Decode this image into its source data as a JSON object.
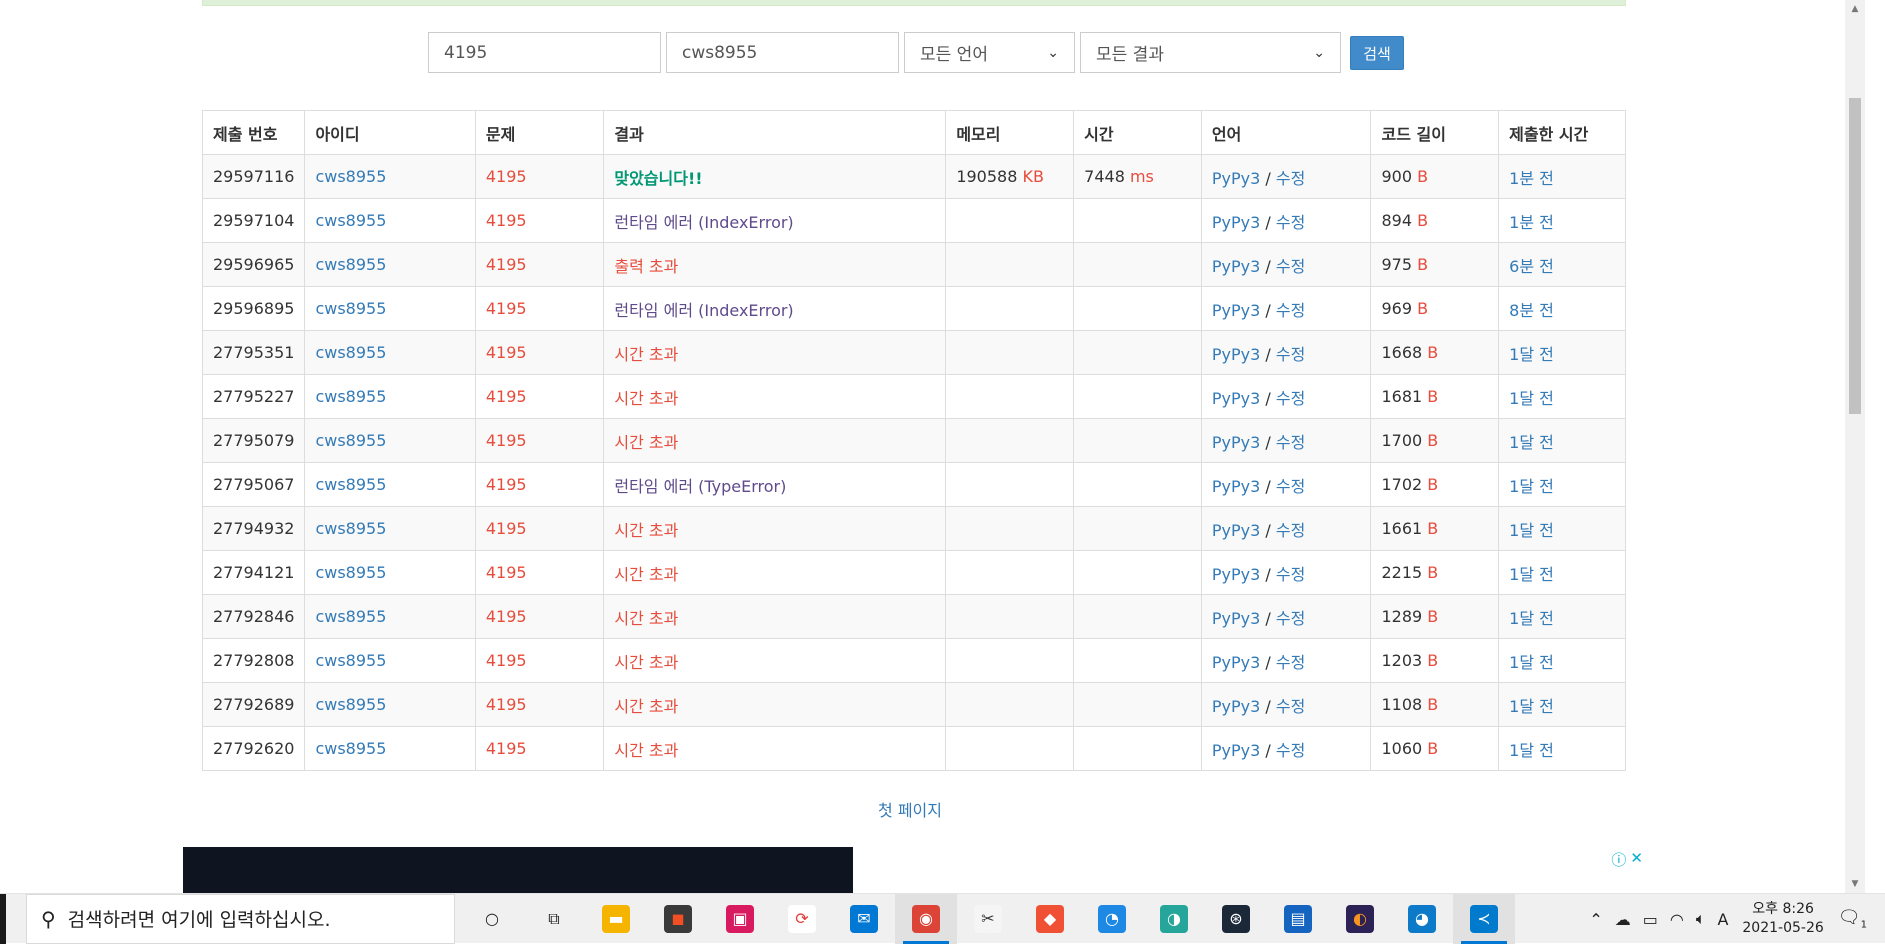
{
  "search": {
    "problem_value": "4195",
    "user_value": "cws8955",
    "language_selected": "모든 언어",
    "result_selected": "모든 결과",
    "button_label": "검색"
  },
  "table": {
    "headers": [
      "제출 번호",
      "아이디",
      "문제",
      "결과",
      "메모리",
      "시간",
      "언어",
      "코드 길이",
      "제출한 시간"
    ],
    "memory_unit": "KB",
    "time_unit": "ms",
    "length_unit": "B",
    "lang_sep": "/",
    "rows": [
      {
        "id": "29597116",
        "user": "cws8955",
        "problem": "4195",
        "result": "맞았습니다!!",
        "result_class": "ac",
        "result_detail": "",
        "memory": "190588",
        "time": "7448",
        "lang": "PyPy3",
        "edit": "수정",
        "length": "900",
        "ago": "1분 전"
      },
      {
        "id": "29597104",
        "user": "cws8955",
        "problem": "4195",
        "result": "런타임 에러",
        "result_class": "rte",
        "result_detail": "(IndexError)",
        "memory": "",
        "time": "",
        "lang": "PyPy3",
        "edit": "수정",
        "length": "894",
        "ago": "1분 전"
      },
      {
        "id": "29596965",
        "user": "cws8955",
        "problem": "4195",
        "result": "출력 초과",
        "result_class": "ole",
        "result_detail": "",
        "memory": "",
        "time": "",
        "lang": "PyPy3",
        "edit": "수정",
        "length": "975",
        "ago": "6분 전"
      },
      {
        "id": "29596895",
        "user": "cws8955",
        "problem": "4195",
        "result": "런타임 에러",
        "result_class": "rte",
        "result_detail": "(IndexError)",
        "memory": "",
        "time": "",
        "lang": "PyPy3",
        "edit": "수정",
        "length": "969",
        "ago": "8분 전"
      },
      {
        "id": "27795351",
        "user": "cws8955",
        "problem": "4195",
        "result": "시간 초과",
        "result_class": "tle",
        "result_detail": "",
        "memory": "",
        "time": "",
        "lang": "PyPy3",
        "edit": "수정",
        "length": "1668",
        "ago": "1달 전"
      },
      {
        "id": "27795227",
        "user": "cws8955",
        "problem": "4195",
        "result": "시간 초과",
        "result_class": "tle",
        "result_detail": "",
        "memory": "",
        "time": "",
        "lang": "PyPy3",
        "edit": "수정",
        "length": "1681",
        "ago": "1달 전"
      },
      {
        "id": "27795079",
        "user": "cws8955",
        "problem": "4195",
        "result": "시간 초과",
        "result_class": "tle",
        "result_detail": "",
        "memory": "",
        "time": "",
        "lang": "PyPy3",
        "edit": "수정",
        "length": "1700",
        "ago": "1달 전"
      },
      {
        "id": "27795067",
        "user": "cws8955",
        "problem": "4195",
        "result": "런타임 에러",
        "result_class": "rte",
        "result_detail": "(TypeError)",
        "memory": "",
        "time": "",
        "lang": "PyPy3",
        "edit": "수정",
        "length": "1702",
        "ago": "1달 전"
      },
      {
        "id": "27794932",
        "user": "cws8955",
        "problem": "4195",
        "result": "시간 초과",
        "result_class": "tle",
        "result_detail": "",
        "memory": "",
        "time": "",
        "lang": "PyPy3",
        "edit": "수정",
        "length": "1661",
        "ago": "1달 전"
      },
      {
        "id": "27794121",
        "user": "cws8955",
        "problem": "4195",
        "result": "시간 초과",
        "result_class": "tle",
        "result_detail": "",
        "memory": "",
        "time": "",
        "lang": "PyPy3",
        "edit": "수정",
        "length": "2215",
        "ago": "1달 전"
      },
      {
        "id": "27792846",
        "user": "cws8955",
        "problem": "4195",
        "result": "시간 초과",
        "result_class": "tle",
        "result_detail": "",
        "memory": "",
        "time": "",
        "lang": "PyPy3",
        "edit": "수정",
        "length": "1289",
        "ago": "1달 전"
      },
      {
        "id": "27792808",
        "user": "cws8955",
        "problem": "4195",
        "result": "시간 초과",
        "result_class": "tle",
        "result_detail": "",
        "memory": "",
        "time": "",
        "lang": "PyPy3",
        "edit": "수정",
        "length": "1203",
        "ago": "1달 전"
      },
      {
        "id": "27792689",
        "user": "cws8955",
        "problem": "4195",
        "result": "시간 초과",
        "result_class": "tle",
        "result_detail": "",
        "memory": "",
        "time": "",
        "lang": "PyPy3",
        "edit": "수정",
        "length": "1108",
        "ago": "1달 전"
      },
      {
        "id": "27792620",
        "user": "cws8955",
        "problem": "4195",
        "result": "시간 초과",
        "result_class": "tle",
        "result_detail": "",
        "memory": "",
        "time": "",
        "lang": "PyPy3",
        "edit": "수정",
        "length": "1060",
        "ago": "1달 전"
      }
    ]
  },
  "pagination": {
    "first_page": "첫 페이지"
  },
  "taskbar": {
    "search_placeholder": "검색하려면 여기에 입력하십시오.",
    "apps": [
      "cortana-icon",
      "task-view-icon",
      "file-explorer-icon",
      "store-icon",
      "red-app-icon",
      "sync-app-icon",
      "mail-icon",
      "chrome-icon",
      "snipping-icon",
      "git-icon",
      "media-icon",
      "refresh-app-icon",
      "steam-icon",
      "reader-icon",
      "eclipse-icon",
      "edge-icon",
      "vscode-icon"
    ],
    "ime_label": "A",
    "clock_time": "오후 8:26",
    "clock_date": "2021-05-26",
    "notification_count": "1"
  },
  "colors": {
    "link": "#337ab7",
    "accepted": "#009874",
    "runtime_error": "#5f4b8b",
    "time_limit": "#e74c3c",
    "search_button": "#428bca"
  }
}
